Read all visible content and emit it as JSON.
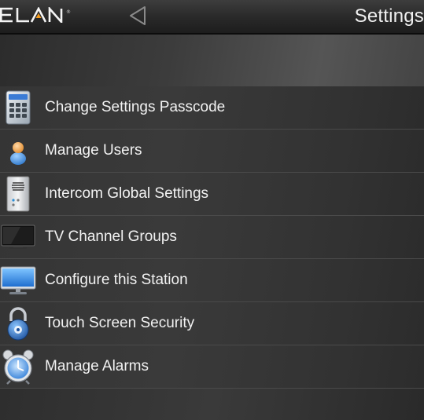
{
  "topbar": {
    "brand": "ELAN",
    "title": "Settings",
    "accent_color": "#f39c1f"
  },
  "menu": {
    "items": [
      {
        "label": "Change Settings Passcode",
        "icon": "keypad-icon"
      },
      {
        "label": "Manage Users",
        "icon": "user-icon"
      },
      {
        "label": "Intercom Global Settings",
        "icon": "intercom-icon"
      },
      {
        "label": "TV Channel Groups",
        "icon": "tv-icon"
      },
      {
        "label": "Configure this Station",
        "icon": "monitor-icon"
      },
      {
        "label": "Touch Screen Security",
        "icon": "padlock-icon"
      },
      {
        "label": "Manage Alarms",
        "icon": "alarm-clock-icon"
      }
    ]
  }
}
